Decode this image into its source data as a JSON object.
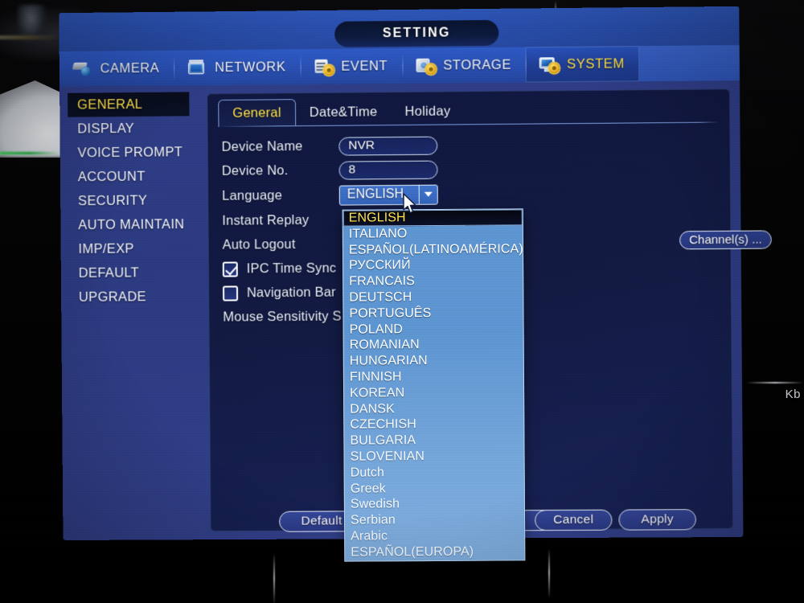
{
  "window": {
    "title": "SETTING"
  },
  "menu": [
    {
      "label": "CAMERA",
      "icon": "camera-icon",
      "active": false
    },
    {
      "label": "NETWORK",
      "icon": "network-icon",
      "active": false
    },
    {
      "label": "EVENT",
      "icon": "event-icon",
      "active": false
    },
    {
      "label": "STORAGE",
      "icon": "storage-icon",
      "active": false
    },
    {
      "label": "SYSTEM",
      "icon": "system-icon",
      "active": true
    }
  ],
  "sidebar": {
    "items": [
      {
        "label": "GENERAL",
        "active": true
      },
      {
        "label": "DISPLAY",
        "active": false
      },
      {
        "label": "VOICE PROMPT",
        "active": false
      },
      {
        "label": "ACCOUNT",
        "active": false
      },
      {
        "label": "SECURITY",
        "active": false
      },
      {
        "label": "AUTO MAINTAIN",
        "active": false
      },
      {
        "label": "IMP/EXP",
        "active": false
      },
      {
        "label": "DEFAULT",
        "active": false
      },
      {
        "label": "UPGRADE",
        "active": false
      }
    ]
  },
  "tabs": [
    {
      "label": "General",
      "active": true
    },
    {
      "label": "Date&Time",
      "active": false
    },
    {
      "label": "Holiday",
      "active": false
    }
  ],
  "form": {
    "device_name_label": "Device Name",
    "device_name_value": "NVR",
    "device_no_label": "Device No.",
    "device_no_value": "8",
    "language_label": "Language",
    "language_value": "ENGLISH",
    "instant_replay_label": "Instant Replay",
    "auto_logout_label": "Auto Logout",
    "channels_button_label": "Channel(s) ...",
    "ipc_time_sync_label": "IPC Time Sync",
    "ipc_time_sync_checked": true,
    "navigation_bar_label": "Navigation Bar",
    "navigation_bar_checked": false,
    "mouse_sensitivity_label": "Mouse Sensitivity  S"
  },
  "buttons": {
    "default_label": "Default",
    "hidden_label": "",
    "cancel_label": "Cancel",
    "apply_label": "Apply"
  },
  "language_dropdown": {
    "selected": "ENGLISH",
    "options": [
      "ENGLISH",
      "ITALIANO",
      "ESPAÑOL(LATINOAMÉRICA)",
      "РУССКИЙ",
      "FRANCAIS",
      "DEUTSCH",
      "PORTUGUÊS",
      "POLAND",
      "ROMANIAN",
      "HUNGARIAN",
      "FINNISH",
      "KOREAN",
      "DANSK",
      "CZECHISH",
      "BULGARIA",
      "SLOVENIAN",
      "Dutch",
      "Greek",
      "Swedish",
      "Serbian",
      "Arabic",
      "ESPAÑOL(EUROPA)"
    ]
  },
  "background": {
    "edge_text": "Kb"
  },
  "colors": {
    "accent_yellow": "#ffe24a",
    "window_blue": "#2c3a80",
    "menubar_blue": "#2950b3",
    "panel_navy": "#121a42",
    "dropdown_blue": "#5d95d1",
    "selected_navy": "#0a1028"
  }
}
